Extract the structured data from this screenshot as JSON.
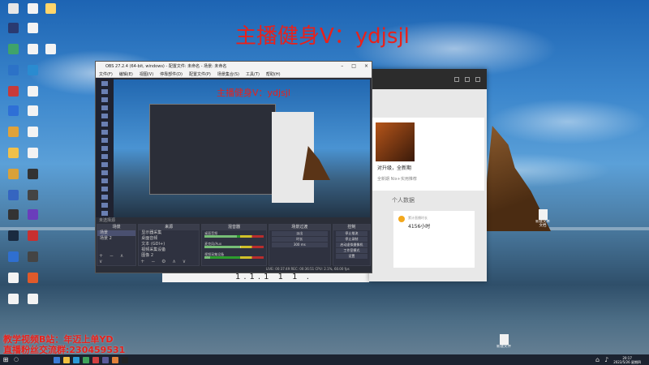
{
  "overlay": {
    "title": "主播健身V：ydjsjl",
    "inner_title": "主播健身V：ydjsjl",
    "tag_line1": "教学视频B站：年迈上单YD",
    "tag_line2": "直播粉丝交流群:230459531"
  },
  "obs": {
    "window_title": "OBS 27.2.4 (64-bit, windows) - 配置文件: 未命名 - 场景: 未命名",
    "menu": [
      "文件(F)",
      "编辑(E)",
      "视图(V)",
      "停靠部件(D)",
      "配置文件(P)",
      "场景集合(S)",
      "工具(T)",
      "帮助(H)"
    ],
    "scene_label": "未选择源",
    "docks": {
      "scenes_header": "场景",
      "scenes": [
        "场景",
        "场景 2"
      ],
      "sources_header": "来源",
      "sources": [
        "显示器采集",
        "桌面音频",
        "文本 (GDI+)",
        "视频采集设备",
        "图像 2",
        "窗口采集"
      ],
      "mixer_header": "混音器",
      "mixer_tracks": [
        {
          "name": "桌面音频",
          "level": 0.55
        },
        {
          "name": "麦克风/Aux",
          "level": 0.62
        },
        {
          "name": "视频采集设备",
          "level": 0.1
        }
      ],
      "transitions_header": "场景过渡",
      "transition_type": "淡出",
      "transition_duration_label": "时长",
      "transition_duration": "300 ms",
      "controls_header": "控制",
      "controls": [
        "停止推流",
        "停止录制",
        "启动虚拟摄像机",
        "工作室模式",
        "设置",
        "退出"
      ]
    },
    "status": "LIVE: 00:37:49   REC: 00:36:51   CPU: 2.1%, 60.00 fps"
  },
  "app": {
    "card_title": "对升级，全新期",
    "card_sub": "全新期 Nix+实用推荐",
    "section_title": "个人数据",
    "stats_label": "累计直播时长",
    "hours": "4156小时"
  },
  "white_app": {
    "text": "1.1.1 1 1 ."
  },
  "desktop_files": [
    {
      "label": "新建文本文档"
    },
    {
      "label": "新建文件"
    }
  ],
  "taskbar": {
    "start_icon": "windows-logo-icon",
    "search_icon": "search-icon",
    "time": "20:17",
    "date": "2022/5/26 星期四"
  },
  "colors": {
    "overlay_red": "#e8211b",
    "obs_bg": "#2b2e38",
    "taskbar": "#1c2330"
  }
}
